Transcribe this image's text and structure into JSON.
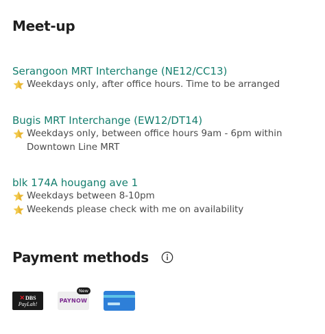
{
  "meetup": {
    "title": "Meet-up",
    "locations": [
      {
        "name": "Serangoon MRT Interchange (NE12/CC13)",
        "notes": [
          "Weekdays only, after office hours. Time to be arranged"
        ]
      },
      {
        "name": "Bugis MRT Interchange (EW12/DT14)",
        "notes": [
          "Weekdays only, between office hours 9am - 6pm within Downtown Line MRT"
        ]
      },
      {
        "name": "blk 174A hougang ave 1",
        "notes": [
          "Weekdays between 8-10pm",
          "Weekends please check with me on availability"
        ]
      }
    ]
  },
  "payment": {
    "title": "Payment methods",
    "info_icon": "info-icon",
    "methods": [
      {
        "id": "dbs-paylah",
        "logo_text": "DBS",
        "logo_subtext": "PayLah!"
      },
      {
        "id": "paynow",
        "logo_text_pay": "PAY",
        "logo_text_now": "NOW",
        "badge": "New"
      },
      {
        "id": "card",
        "icon": "credit-card-icon"
      }
    ]
  },
  "colors": {
    "link": "#147e6e",
    "star": "#f2c94c",
    "dbs_bg": "#1a1a1a",
    "paynow_purple": "#7b2a8f",
    "card_blue": "#2e7fd8"
  }
}
